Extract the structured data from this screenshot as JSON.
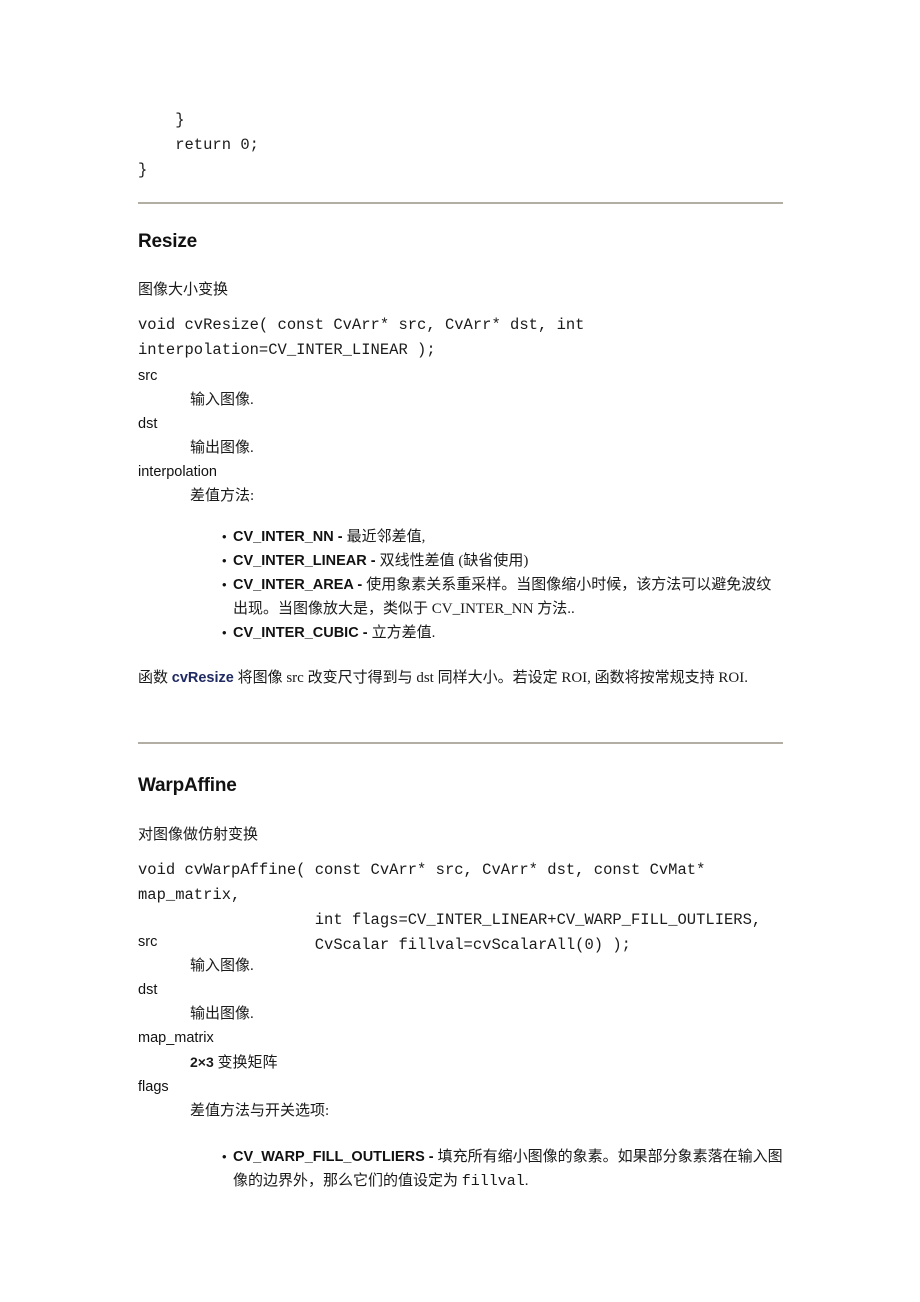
{
  "document": {
    "language": "zh-CN",
    "code_tail": {
      "line1": "    }",
      "line2": "    return 0;",
      "line3": "}"
    },
    "sections": [
      {
        "id": "resize",
        "title": "Resize",
        "summary": "图像大小变换",
        "signature": "void cvResize( const CvArr* src, CvArr* dst, int\ninterpolation=CV_INTER_LINEAR );",
        "params": [
          {
            "term": "src",
            "definition": "输入图像."
          },
          {
            "term": "dst",
            "definition": "输出图像."
          },
          {
            "term": "interpolation",
            "definition": "差值方法:"
          }
        ],
        "constants": [
          {
            "name": "CV_INTER_NN",
            "separator": " - ",
            "description": "最近邻差值,"
          },
          {
            "name": "CV_INTER_LINEAR",
            "separator": " - ",
            "description": "双线性差值 (缺省使用)"
          },
          {
            "name": "CV_INTER_AREA",
            "separator": " - ",
            "description_part1": "使用象素关系重采样。当图像缩小时候，该方法可以避免波纹出现。当图像放大是，类似于 ",
            "inline_const": "CV_INTER_NN",
            "description_part2": " 方法.."
          },
          {
            "name": "CV_INTER_CUBIC",
            "separator": " - ",
            "description": "立方差值."
          }
        ],
        "description": {
          "prefix": "函数 ",
          "link": "cvResize",
          "suffix": " 将图像 src 改变尺寸得到与 dst 同样大小。若设定 ROI, 函数将按常规支持 ROI."
        }
      },
      {
        "id": "warpaffine",
        "title": "WarpAffine",
        "summary": "对图像做仿射变换",
        "signature": "void cvWarpAffine( const CvArr* src, CvArr* dst, const CvMat* map_matrix,\n                   int flags=CV_INTER_LINEAR+CV_WARP_FILL_OUTLIERS,\n                   CvScalar fillval=cvScalarAll(0) );",
        "params": [
          {
            "term": "src",
            "definition": "输入图像."
          },
          {
            "term": "dst",
            "definition": "输出图像."
          },
          {
            "term": "map_matrix",
            "definition_prefix": "2×3",
            "definition_suffix": " 变换矩阵"
          },
          {
            "term": "flags",
            "definition": "差值方法与开关选项:"
          }
        ],
        "constants": [
          {
            "name": "CV_WARP_FILL_OUTLIERS",
            "separator": " - ",
            "description_part1": "填充所有缩小图像的象素。如果部分象素落在输入图像的边界外，那么它们的值设定为 ",
            "inline_code": "fillval",
            "description_part2": "."
          }
        ]
      }
    ],
    "colors": {
      "rule": "#b3aea4",
      "link": "#1f2a63",
      "text": "#1a1a1a",
      "heading": "#111111",
      "background": "#ffffff"
    }
  }
}
